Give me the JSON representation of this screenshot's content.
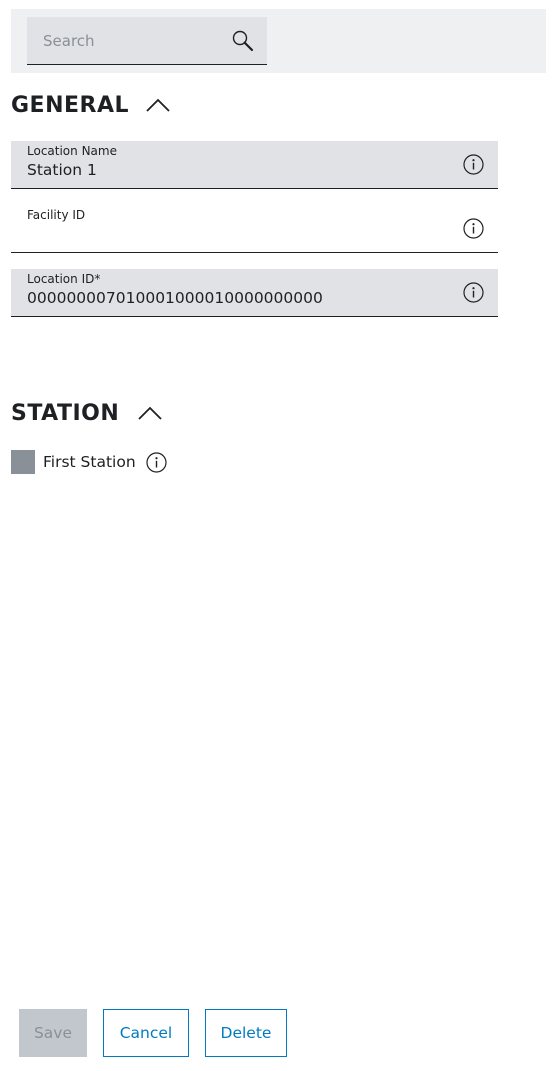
{
  "search": {
    "placeholder": "Search",
    "value": "",
    "icon": "search-icon"
  },
  "general": {
    "title": "GENERAL",
    "expanded": true,
    "fields": [
      {
        "label": "Location Name",
        "value": "Station 1",
        "icon": "info-icon"
      },
      {
        "label": "Facility ID",
        "value": "",
        "icon": "info-icon"
      },
      {
        "label": "Location ID*",
        "value": "000000007010001000010000000000",
        "icon": "info-icon"
      }
    ]
  },
  "station": {
    "title": "STATION",
    "expanded": true,
    "first_station": {
      "label": "First Station",
      "checked": false,
      "icon": "info-icon"
    }
  },
  "actions": {
    "save_label": "Save",
    "cancel_label": "Cancel",
    "delete_label": "Delete"
  },
  "colors": {
    "accent": "#007bc0",
    "field_bg": "#e0e2e5",
    "disabled": "#c1c7cc",
    "checkbox": "#8a9097"
  }
}
